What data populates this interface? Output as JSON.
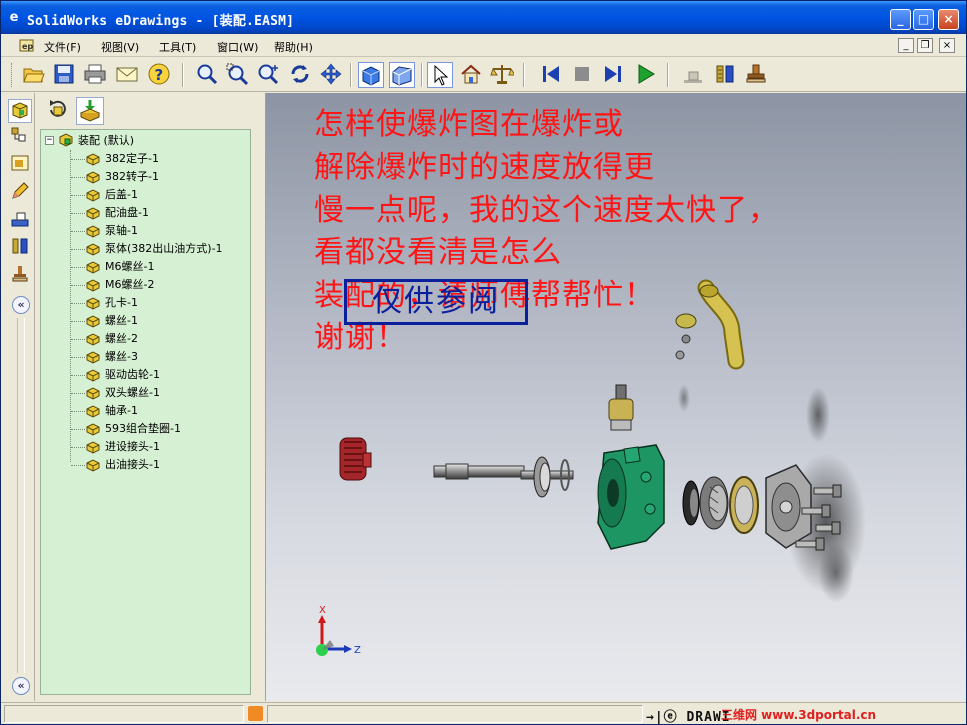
{
  "window": {
    "title": "SolidWorks eDrawings - [装配.EASM]",
    "app_glyph": "e",
    "min_glyph": "_",
    "max_glyph": "□",
    "close_glyph": "×"
  },
  "menubar": {
    "app_icon": "eDrawings-doc-icon",
    "items": [
      {
        "label": "文件(F)"
      },
      {
        "label": "视图(V)"
      },
      {
        "label": "工具(T)"
      },
      {
        "label": "窗口(W)"
      },
      {
        "label": "帮助(H)"
      }
    ],
    "mdi": {
      "min": "_",
      "restore": "❐",
      "close": "×"
    }
  },
  "toolbar": {
    "buttons": [
      {
        "name": "open-icon",
        "glyph": "📂"
      },
      {
        "name": "save-icon",
        "glyph": "💾"
      },
      {
        "name": "print-icon",
        "glyph": "🖨"
      },
      {
        "name": "send-mail-icon",
        "glyph": "✉"
      },
      {
        "name": "help-icon",
        "glyph": "?"
      },
      {
        "name": "zoom-to-fit-icon",
        "glyph": "🔍"
      },
      {
        "name": "zoom-area-icon",
        "glyph": "🔍"
      },
      {
        "name": "zoom-icon",
        "glyph": "🔍"
      },
      {
        "name": "rotate-icon",
        "glyph": "⟳"
      },
      {
        "name": "pan-icon",
        "glyph": "✥"
      },
      {
        "name": "shaded-icon",
        "glyph": "▣"
      },
      {
        "name": "perspective-icon",
        "glyph": "◈"
      },
      {
        "name": "select-icon",
        "glyph": "↖"
      },
      {
        "name": "home-icon",
        "glyph": "⌂"
      },
      {
        "name": "measure-icon",
        "glyph": "⚖"
      },
      {
        "name": "first-frame-icon",
        "glyph": "⏮"
      },
      {
        "name": "stop-icon",
        "glyph": "■"
      },
      {
        "name": "next-frame-icon",
        "glyph": "⏭"
      },
      {
        "name": "play-icon",
        "glyph": "▶"
      },
      {
        "name": "hide-icon",
        "glyph": "▬"
      },
      {
        "name": "explode-icon",
        "glyph": "▦"
      },
      {
        "name": "stamp-icon",
        "glyph": "⚲"
      }
    ]
  },
  "vtabs": {
    "items": [
      {
        "name": "components-tab-icon",
        "glyph": "⬢"
      },
      {
        "name": "configurations-tab-icon",
        "glyph": "⧉"
      },
      {
        "name": "sheets-tab-icon",
        "glyph": "▤"
      },
      {
        "name": "markup-tab-icon",
        "glyph": "✎"
      },
      {
        "name": "sections-tab-icon",
        "glyph": "⊡"
      },
      {
        "name": "explode-tab-icon",
        "glyph": "▥"
      },
      {
        "name": "stamp-tab-icon",
        "glyph": "⚲"
      }
    ],
    "collapse_glyph": "«"
  },
  "panel": {
    "tools": [
      {
        "name": "reload-components-icon",
        "glyph": "⟲"
      },
      {
        "name": "show-all-icon",
        "glyph": "⬇"
      }
    ],
    "tree": {
      "expander": "−",
      "root": "装配 (默认)",
      "items": [
        "382定子-1",
        "382转子-1",
        "后盖-1",
        "配油盘-1",
        "泵轴-1",
        "泵体(382出山油方式)-1",
        "M6螺丝-1",
        "M6螺丝-2",
        "孔卡-1",
        "螺丝-1",
        "螺丝-2",
        "螺丝-3",
        "驱动齿轮-1",
        "双头螺丝-1",
        "轴承-1",
        "593组合垫圈-1",
        "进设接头-1",
        "出油接头-1"
      ]
    }
  },
  "viewport": {
    "note": [
      "怎样使爆炸图在爆炸或",
      "解除爆炸时的速度放得更",
      "慢一点呢，我的这个速度太快了，",
      "看都没看清是怎么",
      "装配的，请师傅帮帮忙！",
      "谢谢！"
    ],
    "watermark": "仅供参阅",
    "triad": {
      "x": "X",
      "z": "Z"
    },
    "colors": {
      "note": "#ff1515",
      "watermark": "#0a1f9c",
      "pump_body": "#1a9a62",
      "gear": "#b8282a",
      "pipe": "#c9b43a"
    }
  },
  "statusbar": {
    "brand": "→|ⓔ DRAWI",
    "site": "三维网 www.3dportal.cn"
  }
}
